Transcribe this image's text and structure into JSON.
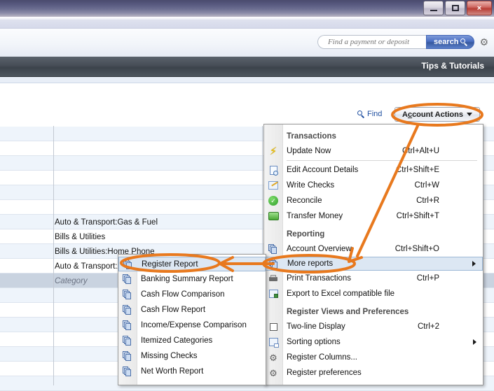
{
  "window": {
    "minimize_label": "Minimize",
    "maximize_label": "Restore",
    "close_label": "×"
  },
  "search": {
    "placeholder": "Find a payment or deposit",
    "value": "",
    "button_label": "search",
    "gear_label": "⚙"
  },
  "navbar": {
    "tips_label": "Tips & Tutorials"
  },
  "toolbar": {
    "find_label": "Find",
    "account_actions_label": "Account Actions",
    "account_actions_accel": "c"
  },
  "register": {
    "column_header": "Category",
    "rows": [
      {
        "category": "",
        "style": "alt"
      },
      {
        "category": "",
        "style": "white"
      },
      {
        "category": "",
        "style": "alt"
      },
      {
        "category": "",
        "style": "white"
      },
      {
        "category": "",
        "style": "alt"
      },
      {
        "category": "",
        "style": "white"
      },
      {
        "category": "Auto & Transport:Gas & Fuel",
        "style": "alt"
      },
      {
        "category": "Bills & Utilities",
        "style": "white"
      },
      {
        "category": "Bills & Utilities:Home Phone",
        "style": "alt"
      },
      {
        "category": "Auto & Transport:Auto Insurance",
        "style": "white"
      },
      {
        "category": "Category",
        "style": "editing"
      },
      {
        "category": "",
        "style": "alt"
      },
      {
        "category": "",
        "style": "white"
      },
      {
        "category": "",
        "style": "alt"
      },
      {
        "category": "",
        "style": "white"
      },
      {
        "category": "",
        "style": "alt"
      },
      {
        "category": "",
        "style": "white"
      },
      {
        "category": "",
        "style": "alt"
      }
    ]
  },
  "account_actions_menu": {
    "sections": [
      {
        "heading": "Transactions",
        "items": [
          {
            "label": "Update Now",
            "shortcut": "Ctrl+Alt+U",
            "icon": "lightning-bolt-icon",
            "submenu": false,
            "selected": false,
            "separator_after": true
          },
          {
            "label": "Edit Account Details",
            "shortcut": "Ctrl+Shift+E",
            "icon": "account-details-icon",
            "submenu": false,
            "selected": false
          },
          {
            "label": "Write Checks",
            "shortcut": "Ctrl+W",
            "icon": "write-check-icon",
            "submenu": false,
            "selected": false
          },
          {
            "label": "Reconcile",
            "shortcut": "Ctrl+R",
            "icon": "reconcile-check-icon",
            "submenu": false,
            "selected": false
          },
          {
            "label": "Transfer Money",
            "shortcut": "Ctrl+Shift+T",
            "icon": "transfer-money-icon",
            "submenu": false,
            "selected": false
          }
        ]
      },
      {
        "heading": "Reporting",
        "items": [
          {
            "label": "Account Overview",
            "shortcut": "Ctrl+Shift+O",
            "icon": "reports-icon",
            "submenu": false,
            "selected": false
          },
          {
            "label": "More reports",
            "shortcut": "",
            "icon": "reports-icon",
            "submenu": true,
            "selected": true
          },
          {
            "label": "Print Transactions",
            "shortcut": "Ctrl+P",
            "icon": "printer-icon",
            "submenu": false,
            "selected": false
          },
          {
            "label": "Export to Excel compatible file",
            "shortcut": "",
            "icon": "excel-export-icon",
            "submenu": false,
            "selected": false
          }
        ]
      },
      {
        "heading": "Register Views and Preferences",
        "items": [
          {
            "label": "Two-line Display",
            "shortcut": "Ctrl+2",
            "icon": "checkbox-icon",
            "submenu": false,
            "selected": false
          },
          {
            "label": "Sorting options",
            "shortcut": "",
            "icon": "sorting-icon",
            "submenu": true,
            "selected": false
          },
          {
            "label": "Register Columns...",
            "shortcut": "",
            "icon": "gear-icon",
            "submenu": false,
            "selected": false
          },
          {
            "label": "Register preferences",
            "shortcut": "",
            "icon": "gear-icon",
            "submenu": false,
            "selected": false
          }
        ]
      }
    ]
  },
  "more_reports_submenu": {
    "items": [
      {
        "label": "Register Report",
        "icon": "reports-icon",
        "selected": true
      },
      {
        "label": "Banking Summary Report",
        "icon": "reports-icon",
        "selected": false
      },
      {
        "label": "Cash Flow Comparison",
        "icon": "reports-icon",
        "selected": false
      },
      {
        "label": "Cash Flow Report",
        "icon": "reports-icon",
        "selected": false
      },
      {
        "label": "Income/Expense Comparison",
        "icon": "reports-icon",
        "selected": false
      },
      {
        "label": "Itemized Categories",
        "icon": "reports-icon",
        "selected": false
      },
      {
        "label": "Missing Checks",
        "icon": "reports-icon",
        "selected": false
      },
      {
        "label": "Net Worth Report",
        "icon": "reports-icon",
        "selected": false
      }
    ]
  },
  "annotations": {
    "color": "#e8791e",
    "highlight_account_actions": "Account Actions",
    "highlight_more_reports": "More reports",
    "highlight_register_report": "Register Report"
  },
  "colors": {
    "accent_orange": "#e8791e",
    "menu_selection": "#dce7f3",
    "search_button": "#4a6fc4",
    "nav_bar": "#474e57",
    "register_selection": "#2a5c96"
  }
}
